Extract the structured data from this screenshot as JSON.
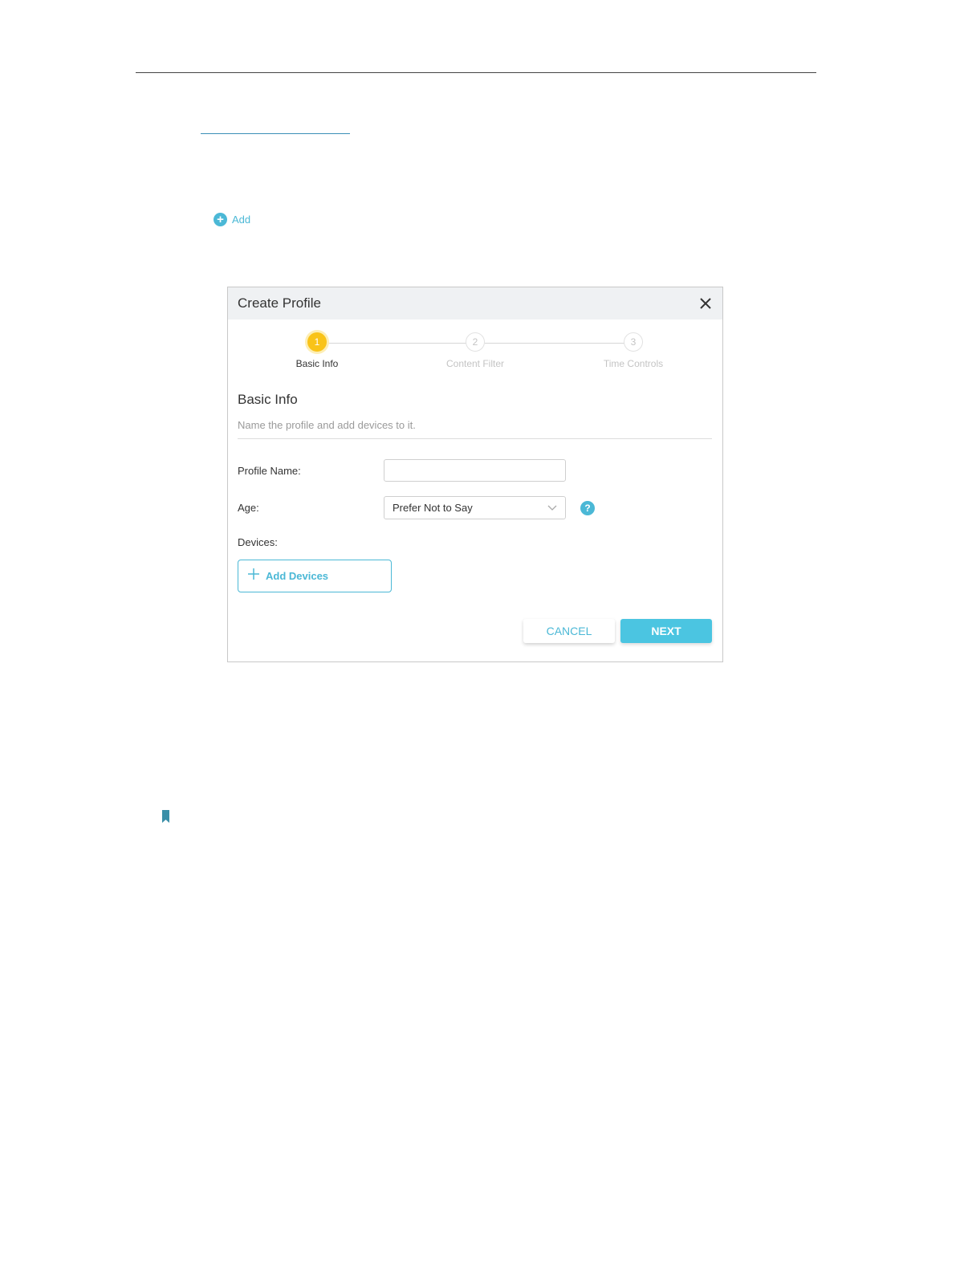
{
  "add_link": {
    "label": "Add",
    "icon": "plus-circle-icon"
  },
  "dialog": {
    "title": "Create Profile",
    "close_icon": "close-icon",
    "steps": [
      {
        "number": "1",
        "label": "Basic Info",
        "state": "active"
      },
      {
        "number": "2",
        "label": "Content Filter",
        "state": "inactive"
      },
      {
        "number": "3",
        "label": "Time Controls",
        "state": "inactive"
      }
    ],
    "section_title": "Basic Info",
    "section_desc": "Name the profile and add devices to it.",
    "fields": {
      "profile_name_label": "Profile Name:",
      "profile_name_value": "",
      "age_label": "Age:",
      "age_value": "Prefer Not to Say",
      "devices_label": "Devices:"
    },
    "add_devices_label": "Add Devices",
    "cancel_label": "CANCEL",
    "next_label": "NEXT"
  },
  "colors": {
    "accent": "#4bb8d6",
    "active_step": "#f9c318",
    "header_bg": "#eff1f3",
    "note_icon": "#3a8fa8"
  },
  "note_icon": "bookmark-icon"
}
